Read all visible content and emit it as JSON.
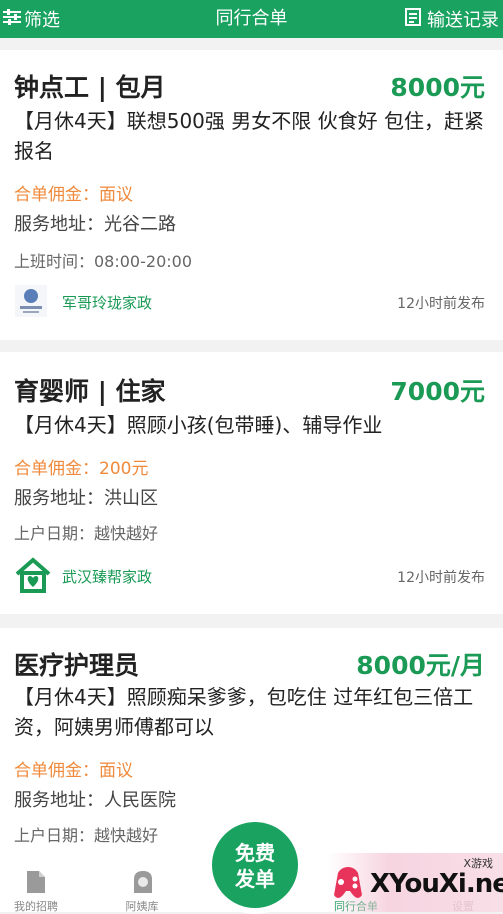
{
  "header": {
    "filter_label": "筛选",
    "title": "同行合单",
    "records_label": "输送记录"
  },
  "jobs": [
    {
      "title": "钟点工 | 包月",
      "salary": "8000元",
      "desc": "【月休4天】联想500强 男女不限 伙食好  包住，赶紧报名",
      "commission": "合单佣金：面议",
      "address": "服务地址：光谷二路",
      "time": "上班时间：08:00-20:00",
      "agency": "军哥玲珑家政",
      "posted": "12小时前发布"
    },
    {
      "title": "育婴师 | 住家",
      "salary": "7000元",
      "desc": "【月休4天】照顾小孩(包带睡)、辅导作业",
      "commission": "合单佣金：200元",
      "address": "服务地址：洪山区",
      "time": "上户日期：越快越好",
      "agency": "武汉臻帮家政",
      "posted": "12小时前发布"
    },
    {
      "title": "医疗护理员",
      "salary": "8000元/月",
      "desc": "【月休4天】照顾痴呆爹爹，包吃住 过年红包三倍工资，阿姨男师傅都可以",
      "commission": "合单佣金：面议",
      "address": "服务地址：人民医院",
      "time": "上户日期：越快越好"
    }
  ],
  "tabbar": {
    "tab1": "我的招聘",
    "tab2": "阿姨库",
    "fab_line1": "免费",
    "fab_line2": "发单",
    "tab4": "同行合单",
    "tab5": "设置"
  },
  "watermark": {
    "small": "X游戏",
    "big": "XYouXi.net"
  },
  "colors": {
    "brand_green": "#1aa260",
    "salary_green": "#1a9a55",
    "commission_orange": "#ef8a3c"
  }
}
